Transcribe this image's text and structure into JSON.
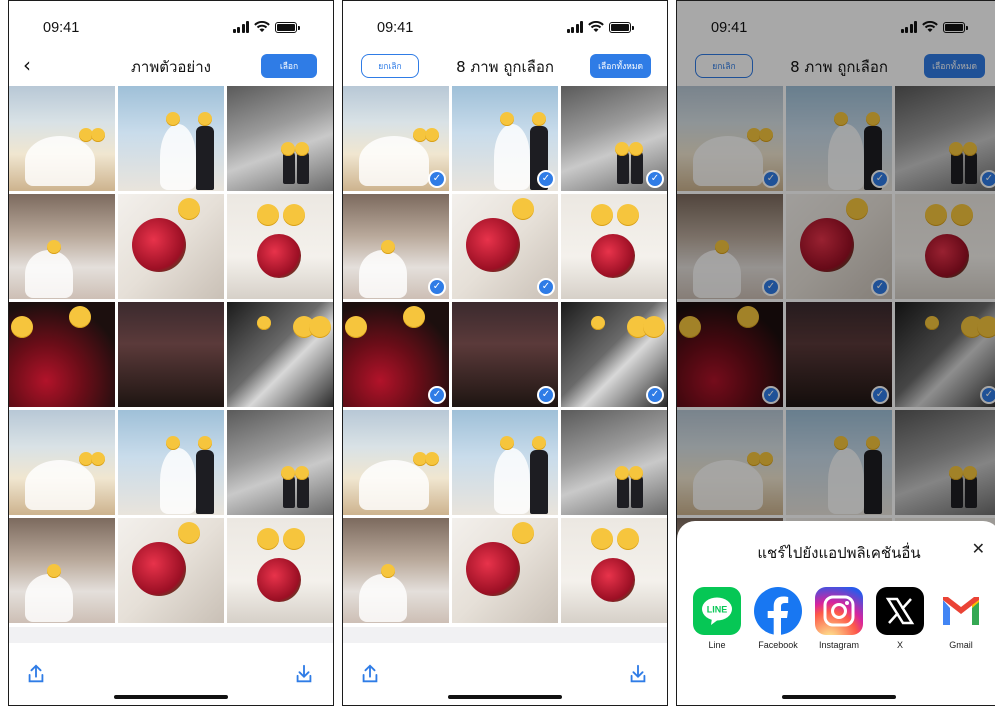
{
  "status_bar": {
    "time": "09:41"
  },
  "screens": {
    "preview": {
      "title": "ภาพตัวอย่าง",
      "back_icon": "chevron-left-icon",
      "select_label": "เลือก"
    },
    "selection": {
      "title": "8 ภาพ ถูกเลือก",
      "cancel_label": "ยกเลิก",
      "select_all_label": "เลือกทั้งหมด"
    },
    "share_sheet": {
      "title": "แชร์ไปยังแอปพลิเคชันอื่น",
      "close_icon": "close-icon",
      "apps": [
        {
          "label": "Line",
          "color": "#06c755"
        },
        {
          "label": "Facebook",
          "color": "#1877f2"
        },
        {
          "label": "Instagram",
          "color": "#d6249f"
        },
        {
          "label": "X",
          "color": "#000000"
        },
        {
          "label": "Gmail",
          "color": "#ea4335"
        }
      ]
    }
  },
  "photos": [
    {
      "kind": "city"
    },
    {
      "kind": "towers"
    },
    {
      "kind": "grey"
    },
    {
      "kind": "hall"
    },
    {
      "kind": "bouq"
    },
    {
      "kind": "bride"
    },
    {
      "kind": "red"
    },
    {
      "kind": "dark"
    },
    {
      "kind": "bw"
    },
    {
      "kind": "city"
    },
    {
      "kind": "towers"
    },
    {
      "kind": "grey"
    },
    {
      "kind": "hall"
    },
    {
      "kind": "bouq"
    },
    {
      "kind": "bride"
    }
  ],
  "selected_indices": [
    1,
    2,
    3,
    4,
    5,
    7,
    8,
    9
  ],
  "toolbar": {
    "share_icon": "share-icon",
    "download_icon": "download-icon"
  },
  "colors": {
    "accent": "#2f7ce6"
  }
}
